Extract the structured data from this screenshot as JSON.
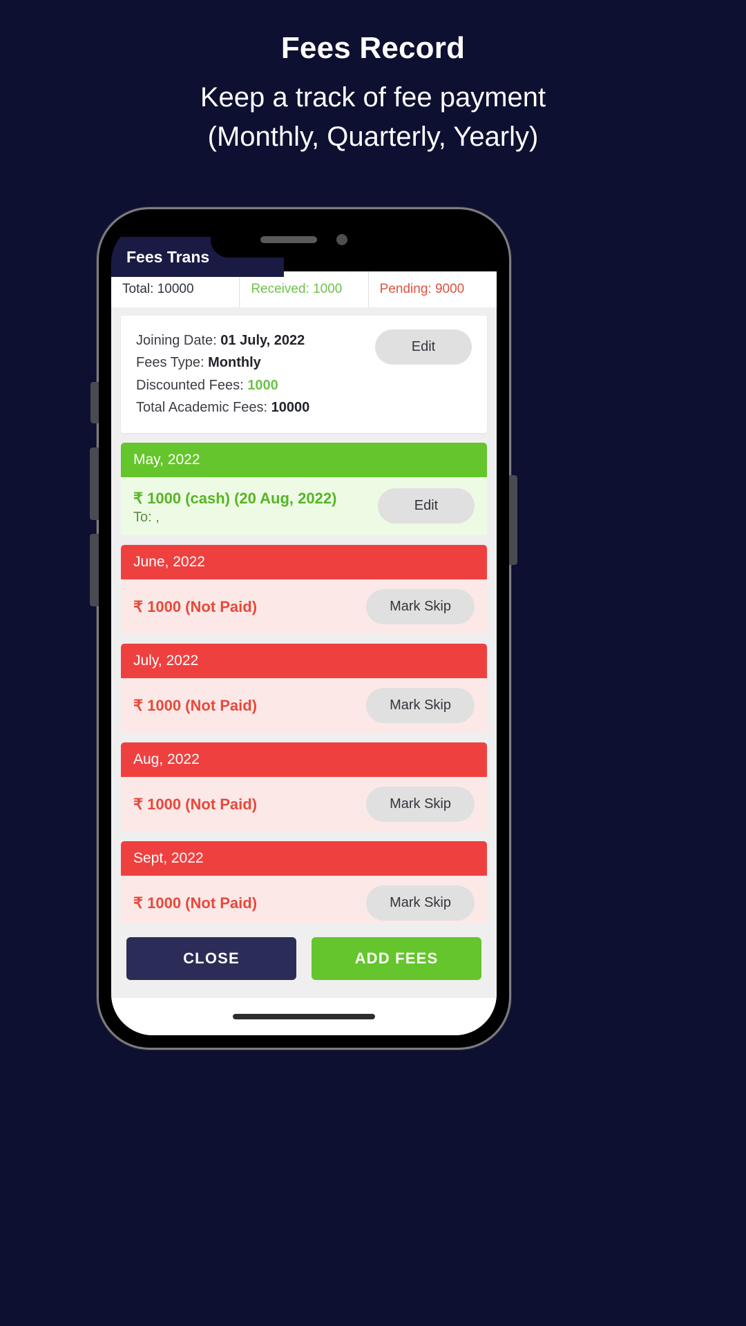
{
  "promo": {
    "title": "Fees Record",
    "subtitle_line1": "Keep a track of fee payment",
    "subtitle_line2": "(Monthly, Quarterly, Yearly)"
  },
  "colors": {
    "page_background": "#0d1030",
    "paid_green": "#65c52c",
    "unpaid_red": "#ef4040",
    "close_navy": "#2b2d58",
    "pending_text": "#e0503f",
    "received_text": "#6ec24a"
  },
  "app": {
    "title": "Fees Trans",
    "summary": {
      "total": "Total: 10000",
      "received": "Received: 1000",
      "pending": "Pending: 9000"
    },
    "info_card": {
      "joining_date_label": "Joining Date: ",
      "joining_date_value": "01 July, 2022",
      "fees_type_label": "Fees Type: ",
      "fees_type_value": "Monthly",
      "discounted_label": "Discounted Fees: ",
      "discounted_value": "1000",
      "total_academic_label": "Total Academic Fees: ",
      "total_academic_value": "10000",
      "edit_label": "Edit"
    },
    "months": [
      {
        "name": "May, 2022",
        "status": "paid",
        "amount": "₹ 1000 (cash) (20 Aug, 2022)",
        "note": "To: ,",
        "action_label": "Edit"
      },
      {
        "name": "June, 2022",
        "status": "unpaid",
        "amount": "₹ 1000 (Not Paid)",
        "note": "",
        "action_label": "Mark Skip"
      },
      {
        "name": "July, 2022",
        "status": "unpaid",
        "amount": "₹ 1000 (Not Paid)",
        "note": "",
        "action_label": "Mark Skip"
      },
      {
        "name": "Aug, 2022",
        "status": "unpaid",
        "amount": "₹ 1000 (Not Paid)",
        "note": "",
        "action_label": "Mark Skip"
      },
      {
        "name": "Sept, 2022",
        "status": "unpaid",
        "amount": "₹ 1000 (Not Paid)",
        "note": "",
        "action_label": "Mark Skip"
      }
    ],
    "actions": {
      "close_label": "CLOSE",
      "add_fees_label": "ADD FEES"
    }
  }
}
